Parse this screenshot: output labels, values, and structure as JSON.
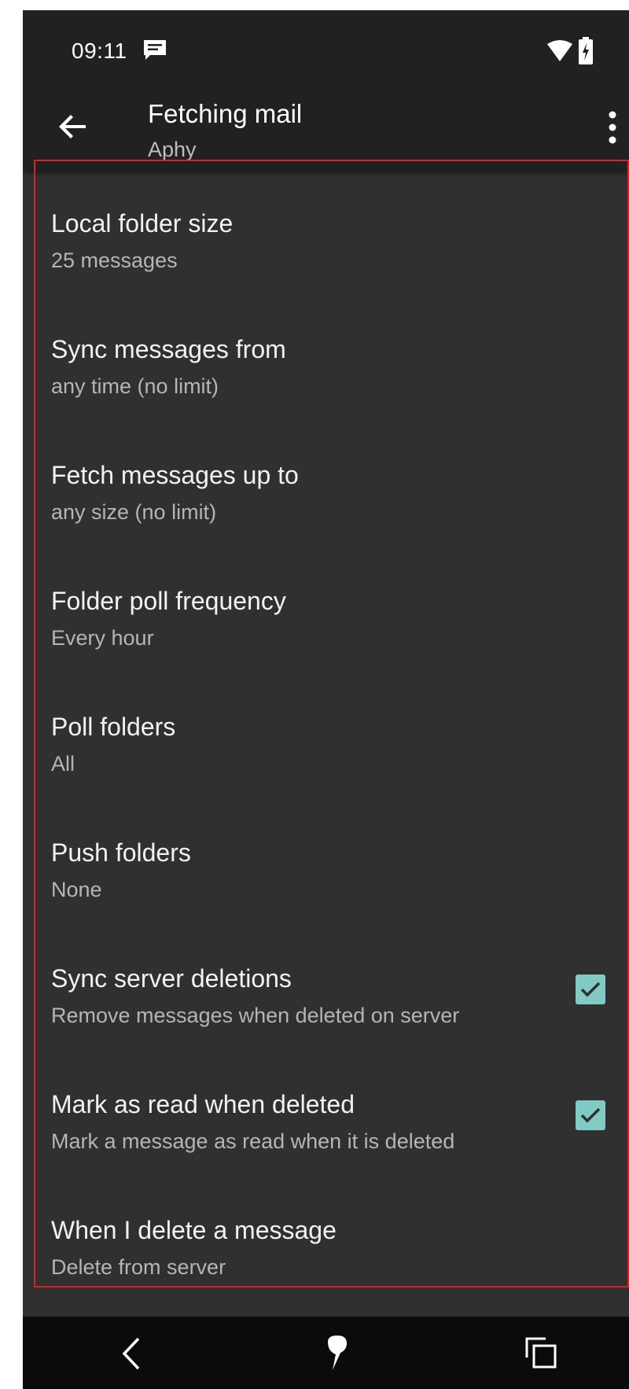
{
  "status_bar": {
    "time": "09:11",
    "icons": [
      "message-notification-icon",
      "wifi-icon",
      "battery-charging-icon"
    ]
  },
  "app_bar": {
    "title": "Fetching mail",
    "subtitle": "Aphy",
    "back_icon": "arrow-back-icon",
    "overflow_icon": "more-vert-icon"
  },
  "preferences": [
    {
      "title": "Local folder size",
      "summary": "25 messages"
    },
    {
      "title": "Sync messages from",
      "summary": "any time (no limit)"
    },
    {
      "title": "Fetch messages up to",
      "summary": "any size (no limit)"
    },
    {
      "title": "Folder poll frequency",
      "summary": "Every hour"
    },
    {
      "title": "Poll folders",
      "summary": "All"
    },
    {
      "title": "Push folders",
      "summary": "None"
    },
    {
      "title": "Sync server deletions",
      "summary": "Remove messages when deleted on server",
      "checked": true
    },
    {
      "title": "Mark as read when deleted",
      "summary": "Mark a message as read when it is deleted",
      "checked": true
    },
    {
      "title": "When I delete a message",
      "summary": "Delete from server"
    }
  ],
  "nav_bar": {
    "icons": [
      "nav-back-icon",
      "nav-home-icon",
      "nav-recents-icon"
    ]
  },
  "colors": {
    "background": "#303030",
    "toolbar": "#212121",
    "accent_checkbox": "#80cbc4",
    "highlight_border": "#e02020"
  }
}
